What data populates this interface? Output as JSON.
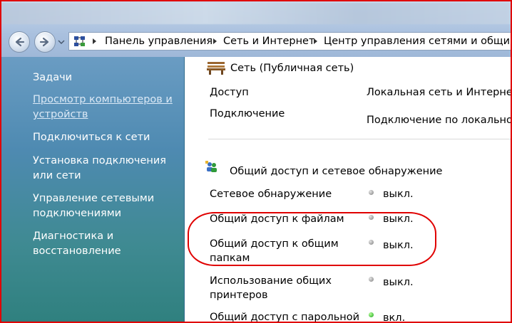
{
  "breadcrumb": {
    "items": [
      "Панель управления",
      "Сеть и Интернет",
      "Центр управления сетями и общим до"
    ]
  },
  "left_pane": {
    "title": "Задачи",
    "items": [
      {
        "label": "Просмотр компьютеров и устройств",
        "link": true
      },
      {
        "label": "Подключиться к сети",
        "link": false
      },
      {
        "label": "Установка подключения или сети",
        "link": false
      },
      {
        "label": "Управление сетевыми подключениями",
        "link": false
      },
      {
        "label": "Диагностика и восстановление",
        "link": false
      }
    ]
  },
  "network": {
    "title": "Сеть (Публичная сеть)",
    "access_label": "Доступ",
    "access_value": "Локальная сеть и Интернет",
    "connection_label": "Подключение",
    "connection_value": "Подключение по локальной с"
  },
  "sharing": {
    "title": "Общий доступ и сетевое обнаружение",
    "items": [
      {
        "label": "Сетевое обнаружение",
        "state": "выкл.",
        "status_color": "#7c7c7c"
      },
      {
        "label": "Общий доступ к файлам",
        "state": "выкл.",
        "status_color": "#7c7c7c"
      },
      {
        "label": "Общий доступ к общим папкам",
        "state": "выкл.",
        "status_color": "#7c7c7c"
      },
      {
        "label": "Использование общих принтеров",
        "state": "выкл.",
        "status_color": "#7c7c7c"
      },
      {
        "label": "Общий доступ с парольной",
        "state": "вкл.",
        "status_color": "#16a319"
      }
    ]
  },
  "colors": {
    "annotation": "#e00000",
    "left_pane_top": "#6a9cc3",
    "left_pane_bottom": "#2f807e"
  }
}
